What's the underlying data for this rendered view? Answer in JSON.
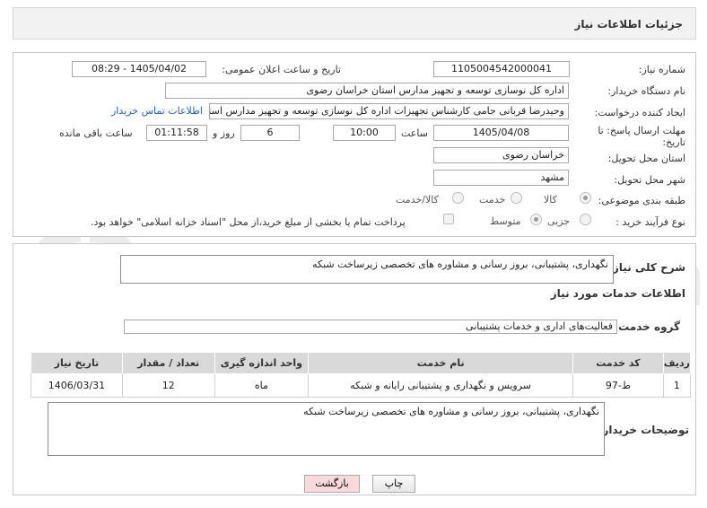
{
  "header": {
    "title": "جزئیات اطلاعات نیاز"
  },
  "form": {
    "need_number_label": "شماره نیاز:",
    "need_number": "1105004542000041",
    "announce_label": "تاریخ و ساعت اعلان عمومی:",
    "announce_value": "1405/04/02 - 08:29",
    "buyer_org_label": "نام دستگاه خریدار:",
    "buyer_org": "اداره کل نوسازی  توسعه و تجهیز مدارس استان خراسان رضوی",
    "creator_label": "ایجاد کننده درخواست:",
    "creator": "وحیدرضا قربانی جامی کارشناس تجهیزات اداره کل نوسازی  توسعه و تجهیز مدارس استان",
    "contact_link": "اطلاعات تماس خریدار",
    "deadline_label_1": "مهلت ارسال پاسخ: تا",
    "deadline_label_2": "تاریخ:",
    "deadline_date": "1405/04/08",
    "time_label": "ساعت",
    "deadline_time": "10:00",
    "days_value": "6",
    "days_label": "روز و",
    "remaining_time": "01:11:58",
    "remaining_label": "ساعت باقی مانده",
    "province_label": "استان محل تحویل:",
    "province": "خراسان رضوی",
    "city_label": "شهر محل تحویل:",
    "city": "مشهد",
    "category_label": "طبقه بندی موضوعی:",
    "category_options": [
      "کالا",
      "خدمت",
      "کالا/خدمت"
    ],
    "process_label": "نوع فرآیند خرید :",
    "process_options": [
      "جزیی",
      "متوسط"
    ],
    "payment_note": "پرداخت تمام یا بخشی از مبلغ خرید،از محل \"اسناد خزانه اسلامی\" خواهد بود."
  },
  "summary": {
    "label": "شرح کلی نیاز:",
    "text": "نگهداری، پشتیبانی، بروز رسانی و مشاوره های تخصصی زیرساخت شبکه"
  },
  "services": {
    "section_title": "اطلاعات خدمات مورد نیاز",
    "group_label": "گروه خدمت:",
    "group_value": "فعالیت‌های اداری و خدمات پشتیبانی",
    "columns": [
      "ردیف",
      "کد خدمت",
      "نام خدمت",
      "واحد اندازه گیری",
      "تعداد / مقدار",
      "تاریخ نیاز"
    ],
    "rows": [
      {
        "row": "1",
        "code": "ط-97",
        "name": "سرویس و نگهداری و پشتیبانی رایانه و شبکه",
        "unit": "ماه",
        "qty": "12",
        "date": "1406/03/31"
      }
    ]
  },
  "buyer_notes": {
    "label": "توضیحات خریدار:",
    "text": "نگهداری، پشتیبانی، بروز رسانی و مشاوره های تخصصی زیرساخت شبکه"
  },
  "buttons": {
    "print": "چاپ",
    "back": "بازگشت"
  },
  "watermark_text": "AriaTender.neT",
  "colors": {
    "link": "#2a61b5",
    "back_button": "#f9d9dc",
    "header_bg": "#f2f2f2",
    "watermark": "#e9e9e9"
  }
}
